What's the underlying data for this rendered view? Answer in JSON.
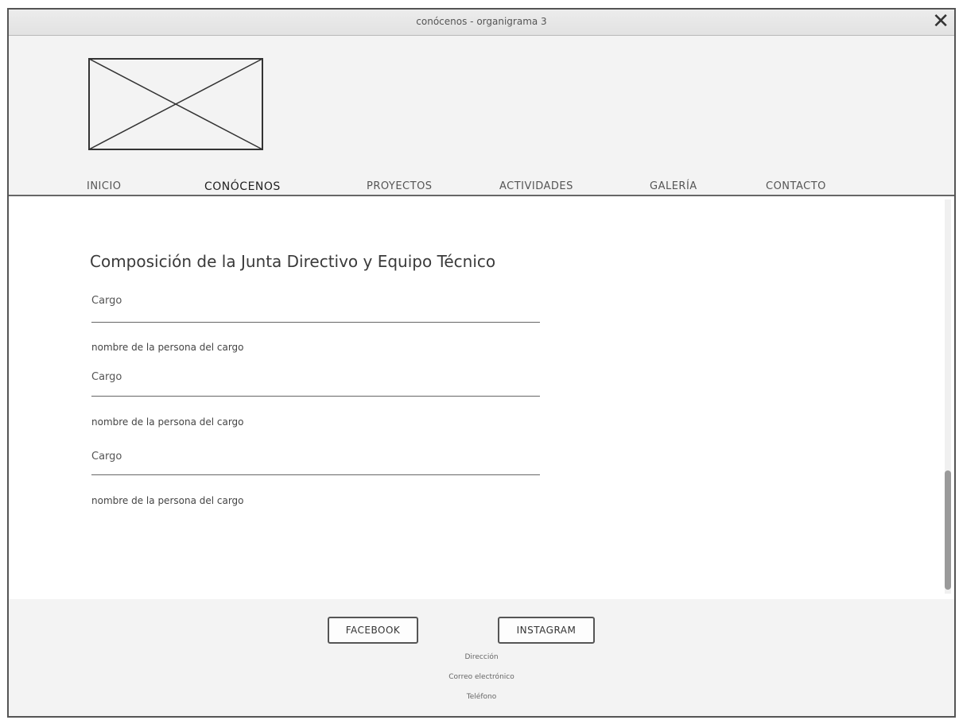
{
  "window": {
    "title": "conócenos - organigrama 3",
    "close_icon": "close-icon"
  },
  "header": {
    "logo": "image-placeholder-icon",
    "nav": [
      {
        "label": "INICIO"
      },
      {
        "label": "CONÓCENOS",
        "active": true
      },
      {
        "label": "PROYECTOS"
      },
      {
        "label": "ACTIVIDADES"
      },
      {
        "label": "GALERÍA"
      },
      {
        "label": "CONTACTO"
      }
    ]
  },
  "main": {
    "title": "Composición de la Junta Directivo y Equipo Técnico",
    "entries": [
      {
        "role": "Cargo",
        "person": "nombre de la persona del cargo"
      },
      {
        "role": "Cargo",
        "person": "nombre de la persona del cargo"
      },
      {
        "role": "Cargo",
        "person": "nombre de la persona del cargo"
      }
    ]
  },
  "footer": {
    "facebook_label": "FACEBOOK",
    "instagram_label": "INSTAGRAM",
    "direccion": "Dirección",
    "correo": "Correo electrónico",
    "telefono": "Teléfono"
  }
}
